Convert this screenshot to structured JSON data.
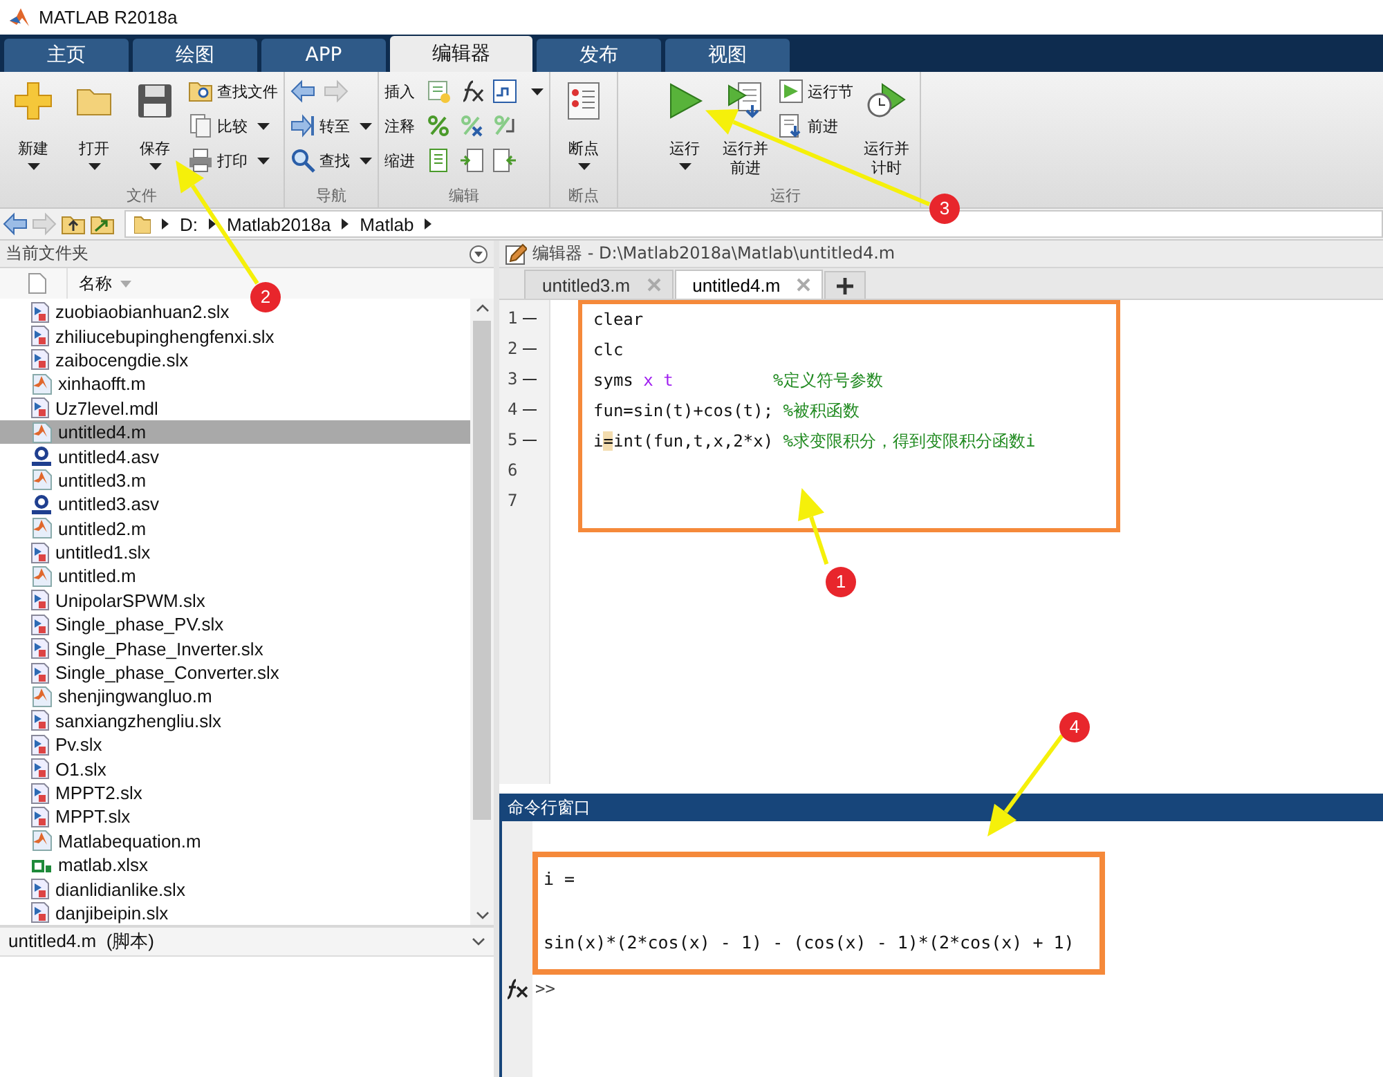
{
  "window": {
    "title": "MATLAB R2018a"
  },
  "tabs": [
    {
      "label": "主页",
      "selected": false
    },
    {
      "label": "绘图",
      "selected": false
    },
    {
      "label": "APP",
      "selected": false
    },
    {
      "label": "编辑器",
      "selected": true
    },
    {
      "label": "发布",
      "selected": false
    },
    {
      "label": "视图",
      "selected": false
    }
  ],
  "toolstrip": {
    "sections": [
      {
        "label": "文件",
        "columns": [
          [
            {
              "kind": "large",
              "label": "新建",
              "dropdown": true
            }
          ],
          [
            {
              "kind": "large",
              "label": "打开",
              "dropdown": true
            }
          ],
          [
            {
              "kind": "large",
              "label": "保存",
              "dropdown": true
            }
          ],
          [
            {
              "kind": "small",
              "label": "查找文件",
              "dropdown": false
            },
            {
              "kind": "small",
              "label": "比较",
              "dropdown": true
            },
            {
              "kind": "small",
              "label": "打印",
              "dropdown": true
            }
          ]
        ]
      },
      {
        "label": "导航",
        "columns": [
          [
            {
              "kind": "icons"
            },
            {
              "kind": "small",
              "label": "转至",
              "dropdown": true
            },
            {
              "kind": "small",
              "label": "查找",
              "dropdown": true
            }
          ]
        ]
      },
      {
        "label": "编辑",
        "columns": [
          [
            {
              "kind": "row",
              "label": "插入",
              "dropdown": true
            },
            {
              "kind": "row",
              "label": "注释",
              "dropdown": false
            },
            {
              "kind": "row",
              "label": "缩进",
              "dropdown": false
            }
          ]
        ]
      },
      {
        "label": "断点",
        "columns": [
          [
            {
              "kind": "large",
              "label": "断点",
              "dropdown": true
            }
          ]
        ]
      },
      {
        "label": "运行",
        "columns": [
          [
            {
              "kind": "large",
              "label": "运行",
              "dropdown": true
            }
          ],
          [
            {
              "kind": "large",
              "label": "运行并前进",
              "dropdown": false
            }
          ],
          [
            {
              "kind": "small",
              "label": "运行节",
              "dropdown": false
            },
            {
              "kind": "small",
              "label": "前进",
              "dropdown": false
            }
          ],
          [
            {
              "kind": "large",
              "label": "运行并计时",
              "dropdown": false
            }
          ]
        ]
      }
    ]
  },
  "address_bar": {
    "path": [
      "D:",
      "Matlab2018a",
      "Matlab"
    ]
  },
  "current_folder": {
    "title": "当前文件夹",
    "column": "名称",
    "files": [
      {
        "name": "zuobiaobianhuan2.slx",
        "kind": "model",
        "selected": false
      },
      {
        "name": "zhiliucebupinghengfenxi.slx",
        "kind": "model",
        "selected": false
      },
      {
        "name": "zaibocengdie.slx",
        "kind": "model",
        "selected": false
      },
      {
        "name": "xinhaofft.m",
        "kind": "script",
        "selected": false
      },
      {
        "name": "Uz7level.mdl",
        "kind": "model",
        "selected": false
      },
      {
        "name": "untitled4.m",
        "kind": "script",
        "selected": true
      },
      {
        "name": "untitled4.asv",
        "kind": "autosave",
        "selected": false
      },
      {
        "name": "untitled3.m",
        "kind": "script",
        "selected": false
      },
      {
        "name": "untitled3.asv",
        "kind": "autosave",
        "selected": false
      },
      {
        "name": "untitled2.m",
        "kind": "script",
        "selected": false
      },
      {
        "name": "untitled1.slx",
        "kind": "model",
        "selected": false
      },
      {
        "name": "untitled.m",
        "kind": "script",
        "selected": false
      },
      {
        "name": "UnipolarSPWM.slx",
        "kind": "model",
        "selected": false
      },
      {
        "name": "Single_phase_PV.slx",
        "kind": "model",
        "selected": false
      },
      {
        "name": "Single_Phase_Inverter.slx",
        "kind": "model",
        "selected": false
      },
      {
        "name": "Single_phase_Converter.slx",
        "kind": "model",
        "selected": false
      },
      {
        "name": "shenjingwangluo.m",
        "kind": "script",
        "selected": false
      },
      {
        "name": "sanxiangzhengliu.slx",
        "kind": "model",
        "selected": false
      },
      {
        "name": "Pv.slx",
        "kind": "model",
        "selected": false
      },
      {
        "name": "O1.slx",
        "kind": "model",
        "selected": false
      },
      {
        "name": "MPPT2.slx",
        "kind": "model",
        "selected": false
      },
      {
        "name": "MPPT.slx",
        "kind": "model",
        "selected": false
      },
      {
        "name": "Matlabequation.m",
        "kind": "script",
        "selected": false
      },
      {
        "name": "matlab.xlsx",
        "kind": "sheet",
        "selected": false
      },
      {
        "name": "dianlidianlike.slx",
        "kind": "model",
        "selected": false
      },
      {
        "name": "danjibeipin.slx",
        "kind": "model",
        "selected": false
      }
    ],
    "details": "untitled4.m  (脚本)"
  },
  "editor": {
    "title": "编辑器 - D:\\Matlab2018a\\Matlab\\untitled4.m",
    "tabs": [
      {
        "label": "untitled3.m",
        "selected": false
      },
      {
        "label": "untitled4.m",
        "selected": true
      }
    ],
    "highlighted": true,
    "lines": [
      {
        "number": "1",
        "executable": true,
        "tokens": [
          {
            "kind": "code",
            "text": "clear"
          }
        ]
      },
      {
        "number": "2",
        "executable": true,
        "tokens": [
          {
            "kind": "code",
            "text": "clc"
          }
        ]
      },
      {
        "number": "3",
        "executable": true,
        "tokens": [
          {
            "kind": "code",
            "text": "syms "
          },
          {
            "kind": "symbol",
            "text": "x t"
          },
          {
            "kind": "comment",
            "text": "          %定义符号参数"
          }
        ]
      },
      {
        "number": "4",
        "executable": true,
        "tokens": [
          {
            "kind": "code",
            "text": "fun=sin(t)+cos(t); "
          },
          {
            "kind": "comment",
            "text": "%被积函数"
          }
        ]
      },
      {
        "number": "5",
        "executable": true,
        "tokens": [
          {
            "kind": "code",
            "text": "i"
          },
          {
            "kind": "warning",
            "text": "="
          },
          {
            "kind": "code",
            "text": "int(fun,t,x,2*x) "
          },
          {
            "kind": "comment",
            "text": "%求变限积分，得到变限积分函数i"
          }
        ]
      },
      {
        "number": "6",
        "executable": false
      },
      {
        "number": "7",
        "executable": false
      }
    ]
  },
  "command_window": {
    "title": "命令行窗口",
    "highlighted": true,
    "output": [
      "i =",
      "sin(x)*(2*cos(x) - 1) - (cos(x) - 1)*(2*cos(x) + 1)"
    ],
    "prompt": ">>"
  },
  "annotations": [
    {
      "number": "1"
    },
    {
      "number": "2"
    },
    {
      "number": "3"
    },
    {
      "number": "4"
    }
  ]
}
